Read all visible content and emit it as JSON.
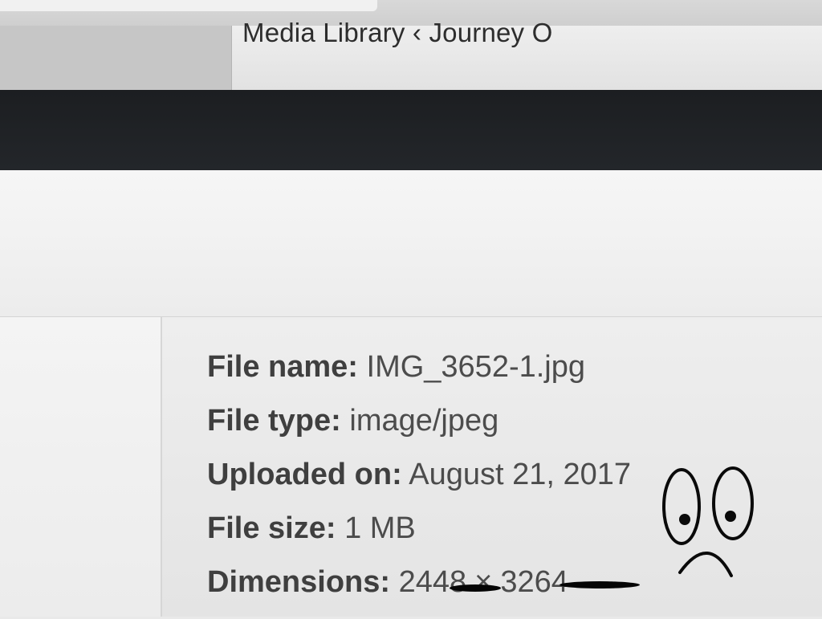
{
  "browser": {
    "tab_title": "Media Library ‹ Journey O"
  },
  "attachment_details": {
    "file_name_label": "File name:",
    "file_name": "IMG_3652-1.jpg",
    "file_type_label": "File type:",
    "file_type": "image/jpeg",
    "uploaded_label": "Uploaded on:",
    "uploaded_on": "August 21, 2017",
    "file_size_label": "File size:",
    "file_size": "1 MB",
    "dimensions_label": "Dimensions:",
    "width": "2448",
    "times": "×",
    "height": "3264"
  },
  "annotation": {
    "icon": "sad-face-doodle",
    "ink_color": "#0a0a0a"
  }
}
